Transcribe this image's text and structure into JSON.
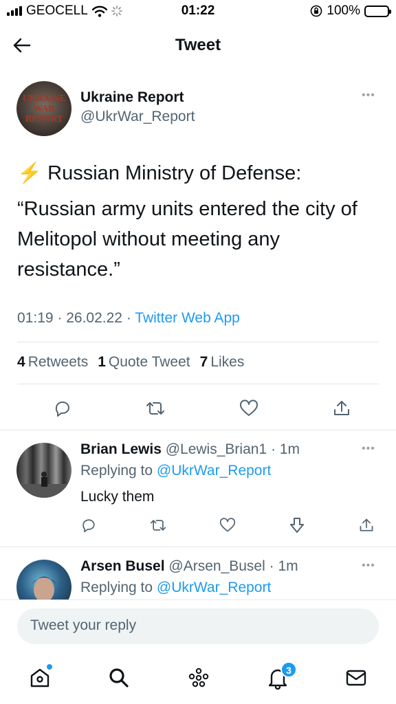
{
  "status_bar": {
    "carrier": "GEOCELL",
    "time": "01:22",
    "battery": "100%"
  },
  "header": {
    "title": "Tweet"
  },
  "tweet": {
    "author_name": "Ukraine Report",
    "author_handle": "@UkrWar_Report",
    "avatar_text": [
      "UKRAINE",
      "WAR",
      "REPORT"
    ],
    "bolt": "⚡",
    "text_line1": "Russian Ministry of Defense:",
    "text_line2": "“Russian army units entered the city of Melitopol without meeting any resistance.”",
    "time": "01:19",
    "date": "26.02.22",
    "source": "Twitter Web App",
    "retweets_count": "4",
    "retweets_label": "Retweets",
    "quotes_count": "1",
    "quotes_label": "Quote Tweet",
    "likes_count": "7",
    "likes_label": "Likes"
  },
  "replies": [
    {
      "name": "Brian Lewis",
      "handle": "@Lewis_Brian1",
      "time": "1m",
      "replying_label": "Replying to",
      "replying_to": "@UkrWar_Report",
      "text": "Lucky them"
    },
    {
      "name": "Arsen Busel",
      "handle": "@Arsen_Busel",
      "time": "1m",
      "replying_label": "Replying to",
      "replying_to": "@UkrWar_Report"
    }
  ],
  "composer": {
    "placeholder": "Tweet your reply"
  },
  "tab_bar": {
    "notifications_badge": "3"
  },
  "colors": {
    "accent": "#1d9bf0",
    "secondary_text": "#536471",
    "bolt": "#f5b800"
  }
}
